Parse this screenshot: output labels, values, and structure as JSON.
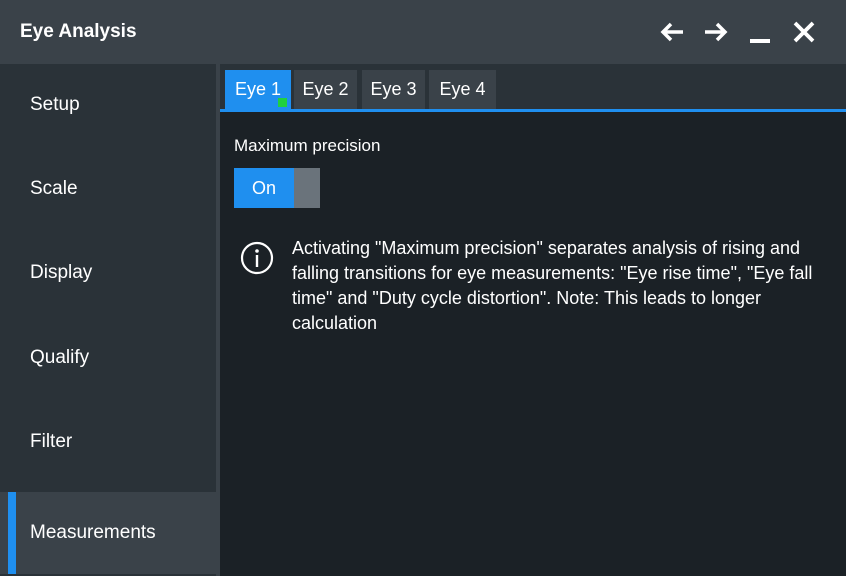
{
  "window": {
    "title": "Eye Analysis",
    "controls": [
      "arrow-left-icon",
      "arrow-right-icon",
      "minimize-icon",
      "close-icon"
    ]
  },
  "sidebar": {
    "items": [
      {
        "label": "Setup",
        "active": false
      },
      {
        "label": "Scale",
        "active": false
      },
      {
        "label": "Display",
        "active": false
      },
      {
        "label": "Qualify",
        "active": false
      },
      {
        "label": "Filter",
        "active": false
      },
      {
        "label": "Measurements",
        "active": true
      }
    ]
  },
  "tabs": [
    {
      "label": "Eye 1",
      "active": true
    },
    {
      "label": "Eye 2",
      "active": false
    },
    {
      "label": "Eye 3",
      "active": false
    },
    {
      "label": "Eye 4",
      "active": false
    }
  ],
  "settings": {
    "max_precision_label": "Maximum precision",
    "toggle_value": "On"
  },
  "info": {
    "icon": "info-icon",
    "text": "Activating \"Maximum precision\" separates analysis of rising and falling transitions for eye measurements: \"Eye rise time\", \"Eye fall time\" and \"Duty cycle distortion\". Note: This leads to longer calculation"
  },
  "colors": {
    "accent": "#1f8fef",
    "indicator": "#20d040",
    "titlebar": "#3a4249",
    "sidebar": "#2a3238",
    "background": "#1b2126"
  }
}
